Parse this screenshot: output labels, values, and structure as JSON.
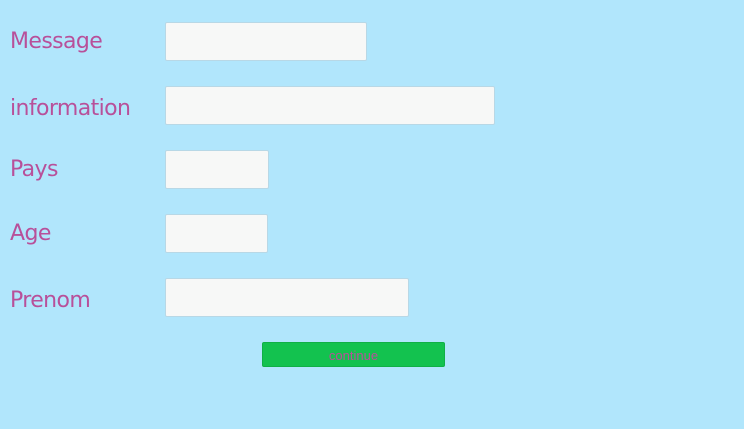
{
  "form": {
    "fields": [
      {
        "label": "Message",
        "value": "",
        "placeholder": ""
      },
      {
        "label": "information",
        "value": "",
        "placeholder": ""
      },
      {
        "label": "Pays",
        "value": "",
        "placeholder": ""
      },
      {
        "label": "Age",
        "value": "",
        "placeholder": ""
      },
      {
        "label": "Prenom",
        "value": "",
        "placeholder": ""
      }
    ],
    "submit_label": "continue"
  },
  "colors": {
    "background": "#b1e6fc",
    "label_text": "#b8509a",
    "input_background": "#f7f8f7",
    "button_background": "#13c24f",
    "button_text": "#b8509a"
  }
}
